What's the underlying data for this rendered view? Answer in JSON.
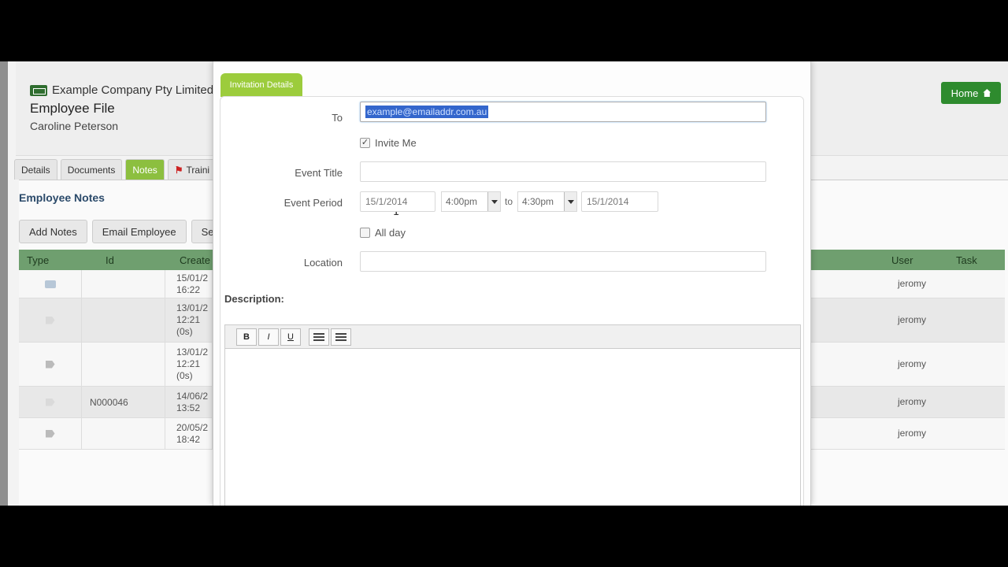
{
  "header": {
    "company": "Example Company Pty Limited",
    "title": "Employee File",
    "employee_name": "Caroline Peterson",
    "home_label": "Home"
  },
  "tabs": [
    {
      "label": "Details"
    },
    {
      "label": "Documents"
    },
    {
      "label": "Notes"
    },
    {
      "label": "Traini"
    }
  ],
  "notes": {
    "heading": "Employee Notes",
    "actions": [
      "Add Notes",
      "Email Employee",
      "Se"
    ],
    "columns": {
      "type": "Type",
      "id": "Id",
      "created": "Create",
      "user": "User",
      "task": "Task"
    },
    "rows": [
      {
        "id": "",
        "created": "15/01/2\n16:22",
        "user": "jeromy"
      },
      {
        "id": "",
        "created": "13/01/2\n12:21\n(0s)",
        "user": "jeromy"
      },
      {
        "id": "",
        "created": "13/01/2\n12:21\n(0s)",
        "user": "jeromy"
      },
      {
        "id": "N000046",
        "created": "14/06/2\n13:52",
        "user": "jeromy"
      },
      {
        "id": "",
        "created": "20/05/2\n18:42",
        "user": "jeromy"
      }
    ]
  },
  "modal": {
    "tab_label": "Invitation Details",
    "to_label": "To",
    "to_value": "example@emailaddr.com.au",
    "invite_me_label": "Invite Me",
    "invite_me_checked": true,
    "event_title_label": "Event Title",
    "event_title_value": "",
    "event_period_label": "Event Period",
    "start_date": "15/1/2014",
    "start_time": "4:00pm",
    "to_word": "to",
    "end_time": "4:30pm",
    "end_date": "15/1/2014",
    "all_day_label": "All day",
    "all_day_checked": false,
    "location_label": "Location",
    "location_value": "",
    "description_label": "Description:",
    "toolbar": {
      "bold": "B",
      "italic": "I",
      "underline": "U"
    }
  },
  "colors": {
    "accent_green": "#9ccc3c",
    "home_green": "#2e8b2e",
    "selection_blue": "#3366cc"
  }
}
